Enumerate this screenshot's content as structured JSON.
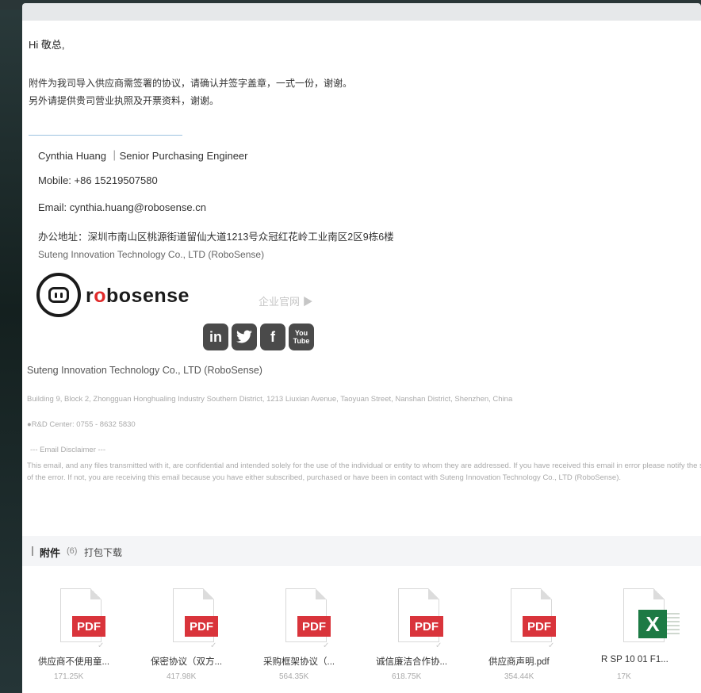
{
  "email": {
    "greeting": "Hi 敬总,",
    "body_line1": "附件为我司导入供应商需签署的协议，请确认并签字盖章，一式一份，谢谢。",
    "body_line2": "另外请提供贵司营业执照及开票资料，谢谢。"
  },
  "signature": {
    "name_title": "Cynthia  Huang ｜Senior Purchasing Engineer",
    "mobile": "Mobile:  +86 15219507580",
    "email": "Email:  cynthia.huang@robosense.cn",
    "office_address": "办公地址：深圳市南山区桃源街道留仙大道1213号众冠红花岭工业南区2区9栋6楼",
    "company": "Suteng Innovation Technology Co., LTD (RoboSense)",
    "brand_pre": "r",
    "brand_mark": "o",
    "brand_post": "bosense",
    "website_link": "企业官网 ▶",
    "social": {
      "linkedin": "in",
      "twitter": "t",
      "facebook": "f",
      "youtube_top": "You",
      "youtube_bottom": "Tube"
    },
    "company_footer": "Suteng Innovation Technology Co., LTD (RoboSense)",
    "address_en": "Building 9, Block 2, Zhongguan Honghualing Industry Southern District, 1213 Liuxian Avenue, Taoyuan Street, Nanshan District, Shenzhen, China",
    "rd_center": "●R&D Center:  0755 - 8632 5830",
    "disclaimer_title": "--- Email Disclaimer ---",
    "disclaimer_line1": "This email, and any files transmitted with it, are confidential and intended solely for the use of the individual or entity to whom they are addressed. If you have received this email in error please notify the sender",
    "disclaimer_line2": "of the error. If not, you are receiving this email because you have either subscribed, purchased or have been in contact with Suteng Innovation Technology Co., LTD (RoboSense)."
  },
  "attachments": {
    "title": "附件",
    "count": "(6)",
    "download_all": "打包下载",
    "files": [
      {
        "name": "供应商不使用童...",
        "size": "171.25K",
        "type": "PDF"
      },
      {
        "name": "保密协议（双方...",
        "size": "417.98K",
        "type": "PDF"
      },
      {
        "name": "采购框架协议（...",
        "size": "564.35K",
        "type": "PDF"
      },
      {
        "name": "诚信廉洁合作协...",
        "size": "618.75K",
        "type": "PDF"
      },
      {
        "name": "供应商声明.pdf",
        "size": "354.44K",
        "type": "PDF"
      },
      {
        "name": "R SP 10 01 F1...",
        "size": "17K",
        "type": "X"
      }
    ]
  }
}
